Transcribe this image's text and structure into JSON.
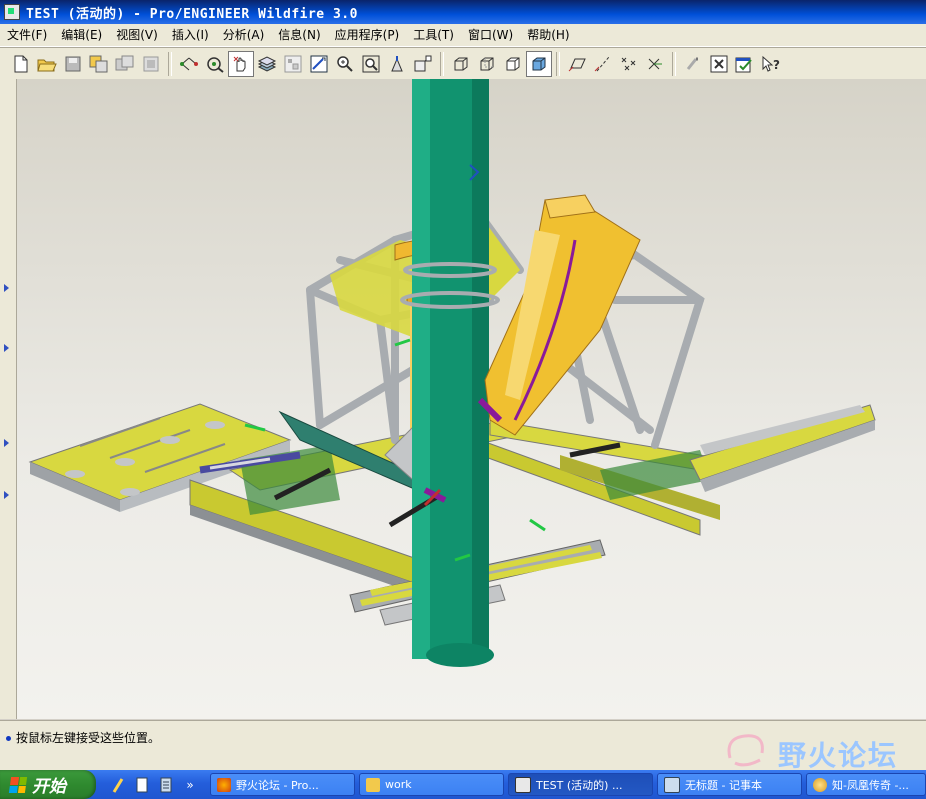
{
  "window": {
    "title": "TEST (活动的) - Pro/ENGINEER Wildfire 3.0"
  },
  "menubar": {
    "items": [
      {
        "label": "文件(F)"
      },
      {
        "label": "编辑(E)"
      },
      {
        "label": "视图(V)"
      },
      {
        "label": "插入(I)"
      },
      {
        "label": "分析(A)"
      },
      {
        "label": "信息(N)"
      },
      {
        "label": "应用程序(P)"
      },
      {
        "label": "工具(T)"
      },
      {
        "label": "窗口(W)"
      },
      {
        "label": "帮助(H)"
      }
    ]
  },
  "toolbar": {
    "icons": [
      "new-file-icon",
      "open-folder-icon",
      "save-icon",
      "save-copy-icon",
      "backup-icon",
      "erase-icon",
      "datum-display-icon",
      "selection-filter-icon",
      "spin-center-icon",
      "layers-icon",
      "model-tree-icon",
      "repaint-icon",
      "zoom-in-icon",
      "zoom-out-icon",
      "refit-icon",
      "orient-icon",
      "wireframe-icon",
      "hidden-line-icon",
      "no-hidden-icon",
      "shading-icon",
      "datum-planes-icon",
      "datum-axes-icon",
      "datum-points-icon",
      "coordinate-systems-icon",
      "regenerate-icon",
      "close-window-icon",
      "verify-icon",
      "context-help-icon"
    ],
    "active_index": 8
  },
  "status": {
    "message": "按鼠标左键接受这些位置。"
  },
  "watermark": {
    "text": "野火论坛"
  },
  "taskbar": {
    "start_label": "开始",
    "overflow": "»",
    "buttons": [
      {
        "label": "野火论坛 - Pro...",
        "active": false
      },
      {
        "label": "work",
        "active": false
      },
      {
        "label": "TEST (活动的) ...",
        "active": true
      },
      {
        "label": "无标题 - 记事本",
        "active": false
      },
      {
        "label": "知-凤凰传奇 -...",
        "active": false
      }
    ]
  },
  "colors": {
    "title_bar": "#0050d8",
    "pipe_green": "#11936f",
    "frame_yellow": "#d8d840",
    "frame_gray": "#a8acb0",
    "cylinder_orange": "#f0b830"
  }
}
